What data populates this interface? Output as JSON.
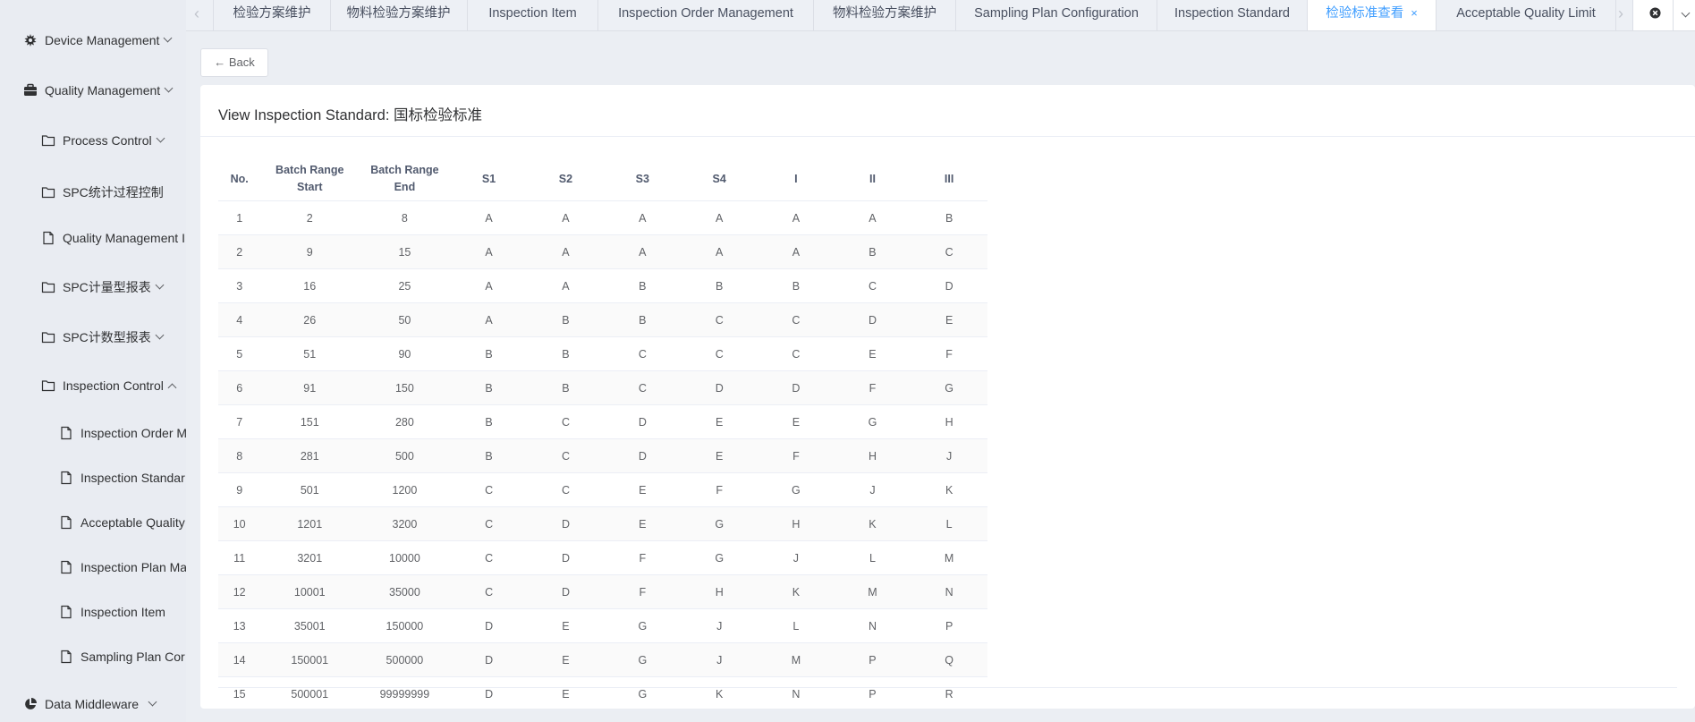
{
  "sidebar": {
    "device_management": "Device Management",
    "quality_management": "Quality Management",
    "process_control": "Process Control",
    "spc_process": "SPC统计过程控制",
    "qm_report": "Quality Management I",
    "spc_measure": "SPC计量型报表",
    "spc_count": "SPC计数型报表",
    "inspection_control": "Inspection Control",
    "inspection_order": "Inspection Order M",
    "inspection_standard": "Inspection Standar",
    "acceptable_quality": "Acceptable Quality",
    "inspection_plan": "Inspection Plan Ma",
    "inspection_item": "Inspection Item",
    "sampling_plan": "Sampling Plan Cor",
    "data_middleware": "Data Middleware"
  },
  "tabs": [
    {
      "label": "检验方案维护"
    },
    {
      "label": "物料检验方案维护"
    },
    {
      "label": "Inspection Item"
    },
    {
      "label": "Inspection Order Management"
    },
    {
      "label": "物料检验方案维护"
    },
    {
      "label": "Sampling Plan Configuration"
    },
    {
      "label": "Inspection Standard"
    },
    {
      "label": "检验标准查看",
      "close": "×"
    },
    {
      "label": "Acceptable Quality Limit"
    }
  ],
  "back_label": "← Back",
  "page_title": "View Inspection Standard: 国标检验标准",
  "table": {
    "columns": [
      "No.",
      "Batch Range Start",
      "Batch Range End",
      "S1",
      "S2",
      "S3",
      "S4",
      "I",
      "II",
      "III"
    ],
    "rows": [
      [
        "1",
        "2",
        "8",
        "A",
        "A",
        "A",
        "A",
        "A",
        "A",
        "B"
      ],
      [
        "2",
        "9",
        "15",
        "A",
        "A",
        "A",
        "A",
        "A",
        "B",
        "C"
      ],
      [
        "3",
        "16",
        "25",
        "A",
        "A",
        "B",
        "B",
        "B",
        "C",
        "D"
      ],
      [
        "4",
        "26",
        "50",
        "A",
        "B",
        "B",
        "C",
        "C",
        "D",
        "E"
      ],
      [
        "5",
        "51",
        "90",
        "B",
        "B",
        "C",
        "C",
        "C",
        "E",
        "F"
      ],
      [
        "6",
        "91",
        "150",
        "B",
        "B",
        "C",
        "D",
        "D",
        "F",
        "G"
      ],
      [
        "7",
        "151",
        "280",
        "B",
        "C",
        "D",
        "E",
        "E",
        "G",
        "H"
      ],
      [
        "8",
        "281",
        "500",
        "B",
        "C",
        "D",
        "E",
        "F",
        "H",
        "J"
      ],
      [
        "9",
        "501",
        "1200",
        "C",
        "C",
        "E",
        "F",
        "G",
        "J",
        "K"
      ],
      [
        "10",
        "1201",
        "3200",
        "C",
        "D",
        "E",
        "G",
        "H",
        "K",
        "L"
      ],
      [
        "11",
        "3201",
        "10000",
        "C",
        "D",
        "F",
        "G",
        "J",
        "L",
        "M"
      ],
      [
        "12",
        "10001",
        "35000",
        "C",
        "D",
        "F",
        "H",
        "K",
        "M",
        "N"
      ],
      [
        "13",
        "35001",
        "150000",
        "D",
        "E",
        "G",
        "J",
        "L",
        "N",
        "P"
      ],
      [
        "14",
        "150001",
        "500000",
        "D",
        "E",
        "G",
        "J",
        "M",
        "P",
        "Q"
      ],
      [
        "15",
        "500001",
        "99999999",
        "D",
        "E",
        "G",
        "K",
        "N",
        "P",
        "R"
      ]
    ]
  },
  "colors": {
    "accent": "#409eff",
    "sidebar_bg": "#e9ecf2",
    "page_bg": "#ebeef3"
  }
}
